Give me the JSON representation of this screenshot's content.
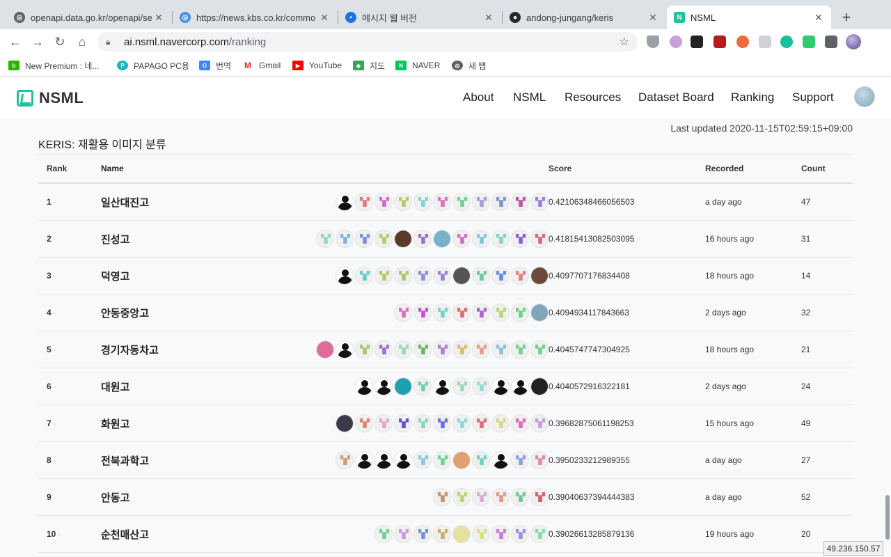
{
  "browser": {
    "tabs": [
      {
        "title": "openapi.data.go.kr/openapi/se",
        "icon": "globe-icon",
        "active": false
      },
      {
        "title": "https://news.kbs.co.kr/commo",
        "icon": "globe-icon",
        "active": false
      },
      {
        "title": "메시지 웹 버전",
        "icon": "message-icon",
        "active": false
      },
      {
        "title": "andong-jungang/keris",
        "icon": "github-icon",
        "active": false
      },
      {
        "title": "NSML",
        "icon": "nsml-icon",
        "active": true
      }
    ],
    "url_host": "ai.nsml.navercorp.com",
    "url_path": "/ranking",
    "bookmarks": [
      {
        "label": "New Premium : 네...",
        "icon": "blog-icon"
      },
      {
        "label": "PAPAGO PC용",
        "icon": "papago-icon"
      },
      {
        "label": "번역",
        "icon": "translate-icon"
      },
      {
        "label": "Gmail",
        "icon": "gmail-icon"
      },
      {
        "label": "YouTube",
        "icon": "youtube-icon"
      },
      {
        "label": "지도",
        "icon": "maps-icon"
      },
      {
        "label": "NAVER",
        "icon": "naver-icon"
      },
      {
        "label": "새 탭",
        "icon": "globe-icon"
      }
    ]
  },
  "site": {
    "logo_text": "NSML",
    "nav": [
      "About",
      "NSML",
      "Resources",
      "Dataset Board",
      "Ranking",
      "Support"
    ]
  },
  "ranking": {
    "last_updated": "Last updated 2020-11-15T02:59:15+09:00",
    "title": "KERIS: 재활용 이미지 분류",
    "columns": {
      "rank": "Rank",
      "name": "Name",
      "score": "Score",
      "recorded": "Recorded",
      "count": "Count"
    },
    "rows": [
      {
        "rank": "1",
        "name": "일산대진고",
        "score": "0.42106348466056503",
        "recorded": "a day ago",
        "count": "47",
        "avatars": [
          "person",
          "#e07a7a",
          "#d36cc3",
          "#b6c96a",
          "#7fd6d6",
          "#e070b8",
          "#6fd38c",
          "#a79be0",
          "#7a95d6",
          "#c84fa8",
          "#9a7fe0"
        ]
      },
      {
        "rank": "2",
        "name": "진성고",
        "score": "0.41815413082503095",
        "recorded": "16 hours ago",
        "count": "31",
        "avatars": [
          "#8fd9c4",
          "#7fb3e0",
          "#7a8fe0",
          "#b6c96a",
          "photo:#5a3a2a",
          "#9a6fd3",
          "photo:#7ab0c8",
          "#d36cc3",
          "#7fc8d6",
          "#7fd6c4",
          "#8a5fd3",
          "#d36c7a"
        ]
      },
      {
        "rank": "3",
        "name": "덕영고",
        "score": "0.4097707176834408",
        "recorded": "18 hours ago",
        "count": "14",
        "avatars": [
          "person",
          "#5fd0d0",
          "#b6c96a",
          "#a8c96a",
          "#8a8fe0",
          "#9a7fe0",
          "photo:#555",
          "#6fc89a",
          "#5f8fe0",
          "#e08080",
          "photo:#6a4a3a"
        ]
      },
      {
        "rank": "4",
        "name": "안동중앙고",
        "score": "0.4094934117843663",
        "recorded": "2 days ago",
        "count": "32",
        "avatars": [
          "#d36cc3",
          "#c84fd8",
          "#6fd0d0",
          "#e06a6a",
          "#b05fe0",
          "#b6d96a",
          "#6fd38c",
          "photo:#7fa7b8"
        ]
      },
      {
        "rank": "5",
        "name": "경기자동차고",
        "score": "0.4045747747304925",
        "recorded": "18 hours ago",
        "count": "21",
        "avatars": [
          "photo:#e06a9a",
          "person",
          "#a8c96a",
          "#9a6fd3",
          "#9ad9b4",
          "#6fb36a",
          "#b07fd3",
          "#e0b86a",
          "#e0a08a",
          "#8ac0e0",
          "#6fd38c",
          "#6fd38c"
        ]
      },
      {
        "rank": "6",
        "name": "대원고",
        "score": "0.4040572916322181",
        "recorded": "2 days ago",
        "count": "24",
        "avatars": [
          "person",
          "person",
          "photo:#1ea0b0",
          "#6fd3a8",
          "person",
          "#9ad9b4",
          "#9ad9d4",
          "person",
          "person",
          "photo:#222"
        ]
      },
      {
        "rank": "7",
        "name": "화원고",
        "score": "0.39682875061198253",
        "recorded": "15 hours ago",
        "count": "49",
        "avatars": [
          "photo:#3a3a4a",
          "#e0806a",
          "#e0a8c8",
          "#5f4fd3",
          "#8ad9b4",
          "#6a6fe0",
          "#8ad9d9",
          "#e06a7a",
          "#d9d98a",
          "#e06ab8",
          "#c89ae0"
        ]
      },
      {
        "rank": "8",
        "name": "전북과학고",
        "score": "0.3950233212989355",
        "recorded": "a day ago",
        "count": "27",
        "avatars": [
          "#c8a07a",
          "person",
          "person",
          "person",
          "#8ac8e0",
          "#6fd38c",
          "photo:#e0a070",
          "#6fd3c4",
          "person",
          "#8a9fe0",
          "#e08aa8"
        ]
      },
      {
        "rank": "9",
        "name": "안동고",
        "score": "0.39040637394444383",
        "recorded": "a day ago",
        "count": "52",
        "avatars": [
          "#c8906a",
          "#b6d96a",
          "#e0a8d8",
          "#e09a8a",
          "#6fc89a",
          "#e05a6a"
        ]
      },
      {
        "rank": "10",
        "name": "순천매산고",
        "score": "0.39026613285879136",
        "recorded": "19 hours ago",
        "count": "20",
        "avatars": [
          "#6fd38c",
          "#c89ae0",
          "#7a8fe0",
          "#c8b06a",
          "photo:#e8e0a0",
          "#d9e07a",
          "#c87ae0",
          "#9a8fe0",
          "#8ad9a8"
        ]
      }
    ]
  },
  "status_ip": "49.236.150.57"
}
